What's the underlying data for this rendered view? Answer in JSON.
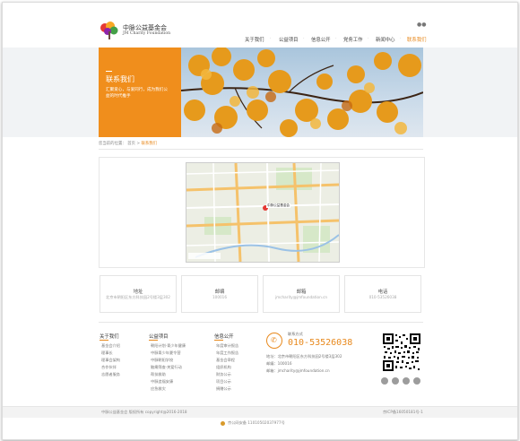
{
  "header": {
    "logo_cn": "中脉公益基金会",
    "logo_en": "JM Charity Foundation",
    "nav": [
      "关于我们",
      "公益项目",
      "信息公开",
      "党务工作",
      "新闻中心",
      "联系我们"
    ],
    "active_index": 5
  },
  "hero": {
    "title": "联系我们",
    "subtitle_line1": "汇聚爱心，与爱同行，成为我们公",
    "subtitle_line2": "益的时代推手"
  },
  "breadcrumb": {
    "prefix": "您当前的位置：",
    "home": "首页",
    "sep": ">",
    "current": "联系我们"
  },
  "map": {
    "label": "中脉公益基金会"
  },
  "contact_cards": [
    {
      "title": "地址",
      "value": "北京市朝阳区东方科技园2号楼3层302"
    },
    {
      "title": "邮编",
      "value": "100016"
    },
    {
      "title": "邮箱",
      "value": "jmcharity@jmfoundation.cn"
    },
    {
      "title": "电话",
      "value": "010-53526038"
    }
  ],
  "footer": {
    "col1": {
      "title": "关于我们",
      "items": [
        "基金会介绍",
        "理事长",
        "理事会架构",
        "合作伙伴",
        "志愿者服务"
      ]
    },
    "col2": {
      "title": "公益项目",
      "items": [
        "朝阳计划·青少年健康",
        "中脉青少年夏令营",
        "中脉朝阳学校",
        "脑瘫筛查·关爱行动",
        "帮扶救助",
        "中脉造福安康",
        "应急救灾"
      ]
    },
    "col3": {
      "title": "信息公开",
      "items": [
        "年度审计报告",
        "年度工作报告",
        "基金会章程",
        "组织机构",
        "财务公示",
        "项目公示",
        "捐赠公示"
      ]
    },
    "contact": {
      "title": "联系方式",
      "phone": "010-53526038",
      "addr": "地址：北京市朝阳区东方科技园2号楼3层302",
      "zip": "邮编：100016",
      "email": "邮箱：jmcharity@jmfoundation.cn"
    }
  },
  "bottom": {
    "left": "中脉公益基金会 版权所有 copyright@2016-2018",
    "right": "京ICP备16050181号-1",
    "police": "京公网安备 11010502037977号"
  }
}
